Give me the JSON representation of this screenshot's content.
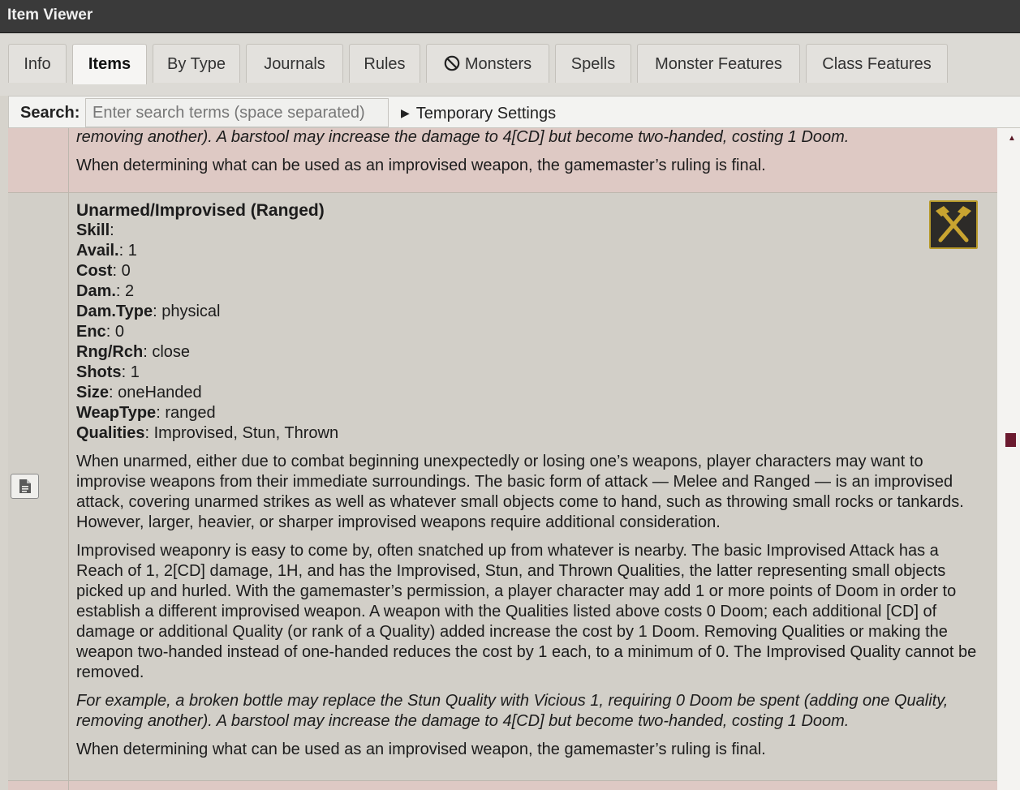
{
  "window": {
    "title": "Item Viewer"
  },
  "tabs": [
    {
      "label": "Info"
    },
    {
      "label": "Items"
    },
    {
      "label": "By Type"
    },
    {
      "label": "Journals"
    },
    {
      "label": "Rules"
    },
    {
      "label": "Monsters"
    },
    {
      "label": "Spells"
    },
    {
      "label": "Monster Features"
    },
    {
      "label": "Class Features"
    }
  ],
  "active_tab": "Items",
  "search": {
    "label": "Search:",
    "value": "",
    "placeholder": "Enter search terms (space separated)",
    "temporary_settings_label": "Temporary Settings"
  },
  "prev_item": {
    "example_tail": "removing another). A barstool may increase the damage to 4[CD] but become two-handed, costing 1 Doom.",
    "ruling": "When determining what can be used as an improvised weapon, the gamemaster’s ruling is final."
  },
  "item": {
    "title": "Unarmed/Improvised (Ranged)",
    "properties": [
      {
        "key": "Skill",
        "value": ""
      },
      {
        "key": "Avail.",
        "value": "1"
      },
      {
        "key": "Cost",
        "value": "0"
      },
      {
        "key": "Dam.",
        "value": "2"
      },
      {
        "key": "Dam.Type",
        "value": "physical"
      },
      {
        "key": "Enc",
        "value": "0"
      },
      {
        "key": "Rng/Rch",
        "value": "close"
      },
      {
        "key": "Shots",
        "value": "1"
      },
      {
        "key": "Size",
        "value": "oneHanded"
      },
      {
        "key": "WeapType",
        "value": "ranged"
      },
      {
        "key": "Qualities",
        "value": "Improvised, Stun, Thrown"
      }
    ],
    "paragraph_1": "When unarmed, either due to combat beginning unexpectedly or losing one’s weapons, player characters may want to improvise weapons from their immediate surroundings. The basic form of attack — Melee and Ranged — is an improvised attack, covering unarmed strikes as well as whatever small objects come to hand, such as throwing small rocks or tankards. However, larger, heavier, or sharper improvised weapons require additional consideration.",
    "paragraph_2": "Improvised weaponry is easy to come by, often snatched up from whatever is nearby. The basic Improvised Attack has a Reach of 1, 2[CD] damage, 1H, and has the Improvised, Stun, and Thrown Qualities, the latter representing small objects picked up and hurled. With the gamemaster’s permission, a player character may add 1 or more points of Doom in order to establish a different improvised weapon. A weapon with the Qualities listed above costs 0 Doom; each additional [CD] of damage or additional Quality (or rank of a Quality) added increase the cost by 1 Doom. Removing Qualities or making the weapon two-handed instead of one-handed reduces the cost by 1 each, to a minimum of 0. The Improvised Quality cannot be removed.",
    "example": "For example, a broken bottle may replace the Stun Quality with Vicious 1, requiring 0 Doom be spent (adding one Quality, removing another). A barstool may increase the damage to 4[CD] but become two-handed, costing 1 Doom.",
    "ruling": "When determining what can be used as an improvised weapon, the gamemaster’s ruling is final.",
    "icon": "crossed-hammers-icon"
  },
  "colors": {
    "titlebar": "#3a3a3a",
    "prev_row": "#dec9c4",
    "main_row": "#d2cfc8",
    "scroll_thumb": "#6b1a2f",
    "icon_gold": "#c9a430"
  }
}
